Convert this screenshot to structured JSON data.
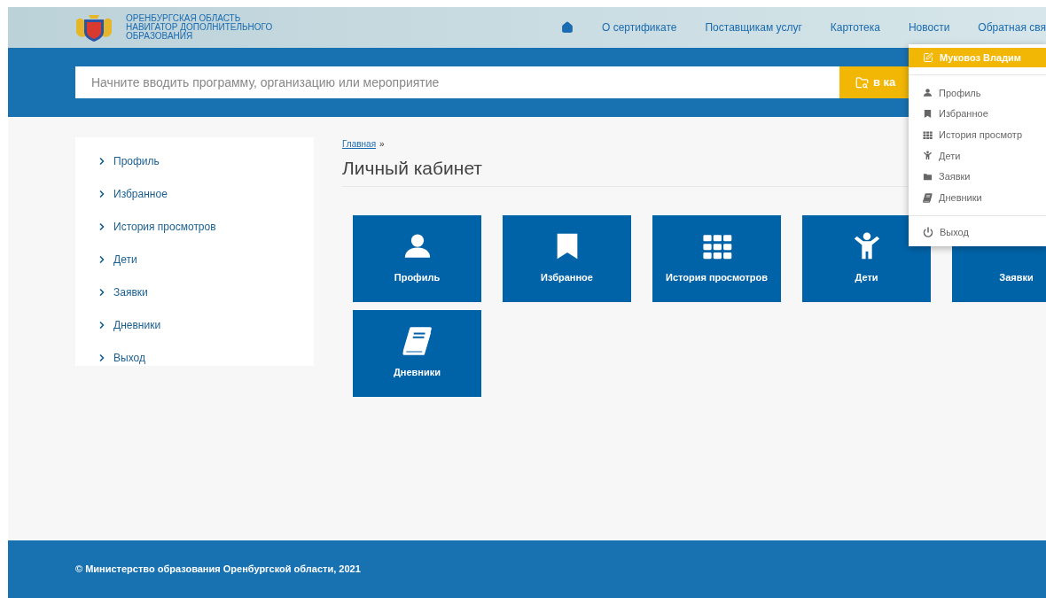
{
  "header": {
    "logo_lines": [
      "ОРЕНБУРГСКАЯ ОБЛАСТЬ",
      "НАВИГАТОР ДОПОЛНИТЕЛЬНОГО",
      "ОБРАЗОВАНИЯ"
    ],
    "nav": [
      {
        "kind": "home"
      },
      {
        "kind": "link",
        "label": "О сертификате"
      },
      {
        "kind": "link",
        "label": "Поставщикам услуг"
      },
      {
        "kind": "link",
        "label": "Картотека"
      },
      {
        "kind": "link",
        "label": "Новости"
      },
      {
        "kind": "link",
        "label": "Обратная свя"
      }
    ]
  },
  "search": {
    "placeholder": "Начните вводить программу, организацию или мероприятие",
    "button": "в ка"
  },
  "sidebar": {
    "items": [
      "Профиль",
      "Избранное",
      "История просмотров",
      "Дети",
      "Заявки",
      "Дневники",
      "Выход"
    ]
  },
  "breadcrumb": {
    "link": "Главная",
    "separator": "»"
  },
  "title": "Личный кабинет",
  "tiles": [
    {
      "label": "Профиль",
      "kind": "user"
    },
    {
      "label": "Избранное",
      "kind": "bookmark"
    },
    {
      "label": "История просмотров",
      "kind": "grid"
    },
    {
      "label": "Дети",
      "kind": "child"
    },
    {
      "label": "Заявки",
      "kind": "covered"
    },
    {
      "label": "Дневники",
      "kind": "book"
    }
  ],
  "user_menu": {
    "user_name": "Муковоз Владим",
    "items": [
      {
        "label": "Профиль",
        "kind": "user"
      },
      {
        "label": "Избранное",
        "kind": "bookmark"
      },
      {
        "label": "История просмотр",
        "kind": "grid"
      },
      {
        "label": "Дети",
        "kind": "child"
      },
      {
        "label": "Заявки",
        "kind": "folder"
      },
      {
        "label": "Дневники",
        "kind": "book"
      }
    ],
    "logout": "Выход"
  },
  "footer": {
    "copyright": "© Министерство образования Оренбургской области, 2021"
  }
}
